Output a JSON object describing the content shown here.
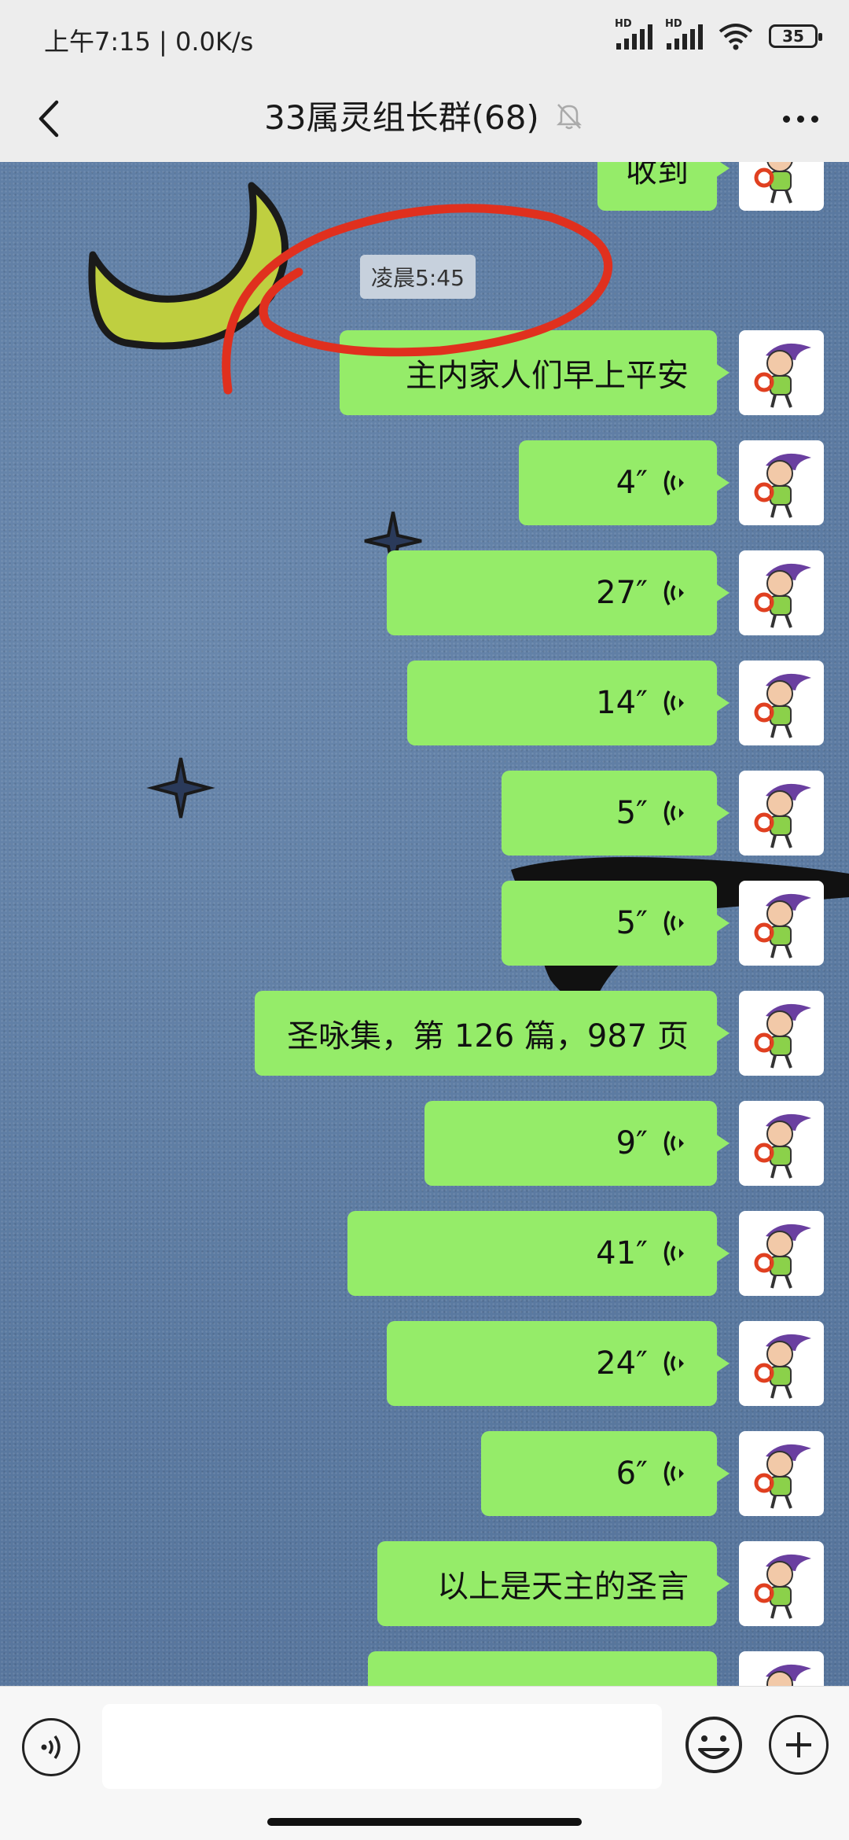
{
  "status_bar": {
    "time_speed": "上午7:15 | 0.0K/s",
    "signal1_label": "HD",
    "signal2_label": "HD",
    "battery": "35",
    "icons": [
      "signal-icon",
      "signal-icon",
      "wifi-icon",
      "battery-icon"
    ]
  },
  "header": {
    "title": "33属灵组长群(68)",
    "icons": [
      "back-icon",
      "mute-bell-icon",
      "more-icon"
    ]
  },
  "chat": {
    "time_divider": "凌晨5:45",
    "top_partial_message": "收到",
    "messages": [
      {
        "type": "text",
        "text": "主内家人们早上平安"
      },
      {
        "type": "voice",
        "duration": "4″"
      },
      {
        "type": "voice",
        "duration": "27″"
      },
      {
        "type": "voice",
        "duration": "14″"
      },
      {
        "type": "voice",
        "duration": "5″"
      },
      {
        "type": "voice",
        "duration": "5″"
      },
      {
        "type": "text",
        "text": "圣咏集，第 126 篇，987 页"
      },
      {
        "type": "voice",
        "duration": "9″"
      },
      {
        "type": "voice",
        "duration": "41″"
      },
      {
        "type": "voice",
        "duration": "24″"
      },
      {
        "type": "voice",
        "duration": "6″"
      },
      {
        "type": "text",
        "text": "以上是天主的圣言"
      }
    ],
    "bubble_color": "#95ec69",
    "annotation_color": "#e0301e"
  },
  "input_bar": {
    "icons": [
      "voice-input-icon",
      "emoji-icon",
      "plus-icon"
    ],
    "text_value": ""
  }
}
